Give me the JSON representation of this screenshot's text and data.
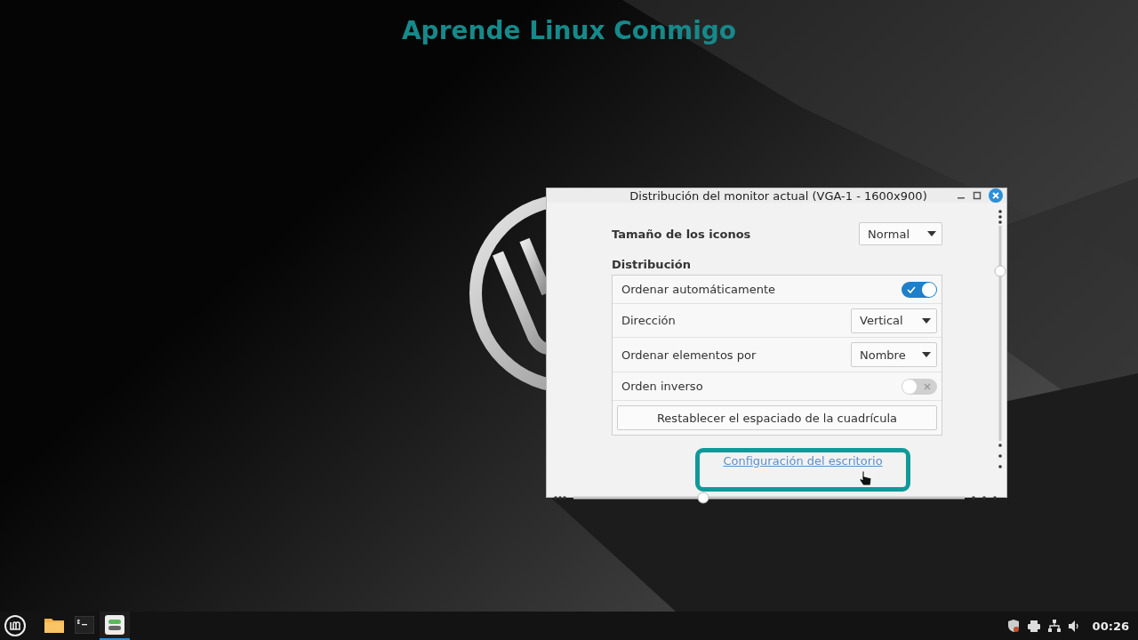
{
  "overlay_title": "Aprende Linux Conmigo",
  "window": {
    "title": "Distribución del monitor actual (VGA-1 - 1600x900)"
  },
  "icon_size": {
    "label": "Tamaño de los iconos",
    "value": "Normal"
  },
  "layout": {
    "heading": "Distribución",
    "rows": [
      {
        "kind": "switch",
        "label": "Ordenar automáticamente",
        "on": true
      },
      {
        "kind": "dropdown",
        "label": "Dirección",
        "value": "Vertical"
      },
      {
        "kind": "dropdown",
        "label": "Ordenar elementos por",
        "value": "Nombre"
      },
      {
        "kind": "switch",
        "label": "Orden inverso",
        "on": false
      },
      {
        "kind": "button",
        "label": "Restablecer el espaciado de la cuadrícula"
      }
    ]
  },
  "link": {
    "label": "Configuración del escritorio",
    "highlighted": true
  },
  "taskbar": {
    "apps": [
      {
        "kind": "files",
        "selected": false
      },
      {
        "kind": "terminal",
        "selected": false
      },
      {
        "kind": "settings",
        "selected": true
      }
    ],
    "clock": "00:26"
  }
}
